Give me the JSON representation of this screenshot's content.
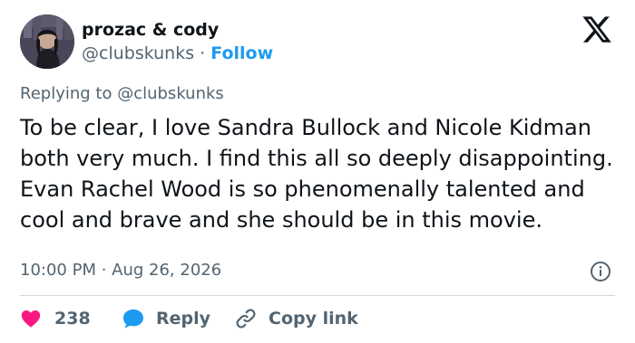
{
  "author": {
    "display_name": "prozac & cody",
    "handle": "@clubskunks",
    "separator": " · ",
    "follow_label": "Follow"
  },
  "replying": {
    "prefix": "Replying to ",
    "mention": "@clubskunks"
  },
  "tweet": {
    "text": "To be clear, I love Sandra Bullock and Nicole Kidman both very much. I find this all so deeply disappointing. Evan Rachel Wood is so phenomenally talented and cool and brave and she should be in this movie.",
    "timestamp": "10:00 PM · Aug 26, 2026"
  },
  "actions": {
    "like_count": "238",
    "reply_label": "Reply",
    "copy_link_label": "Copy link"
  },
  "icons": {
    "logo": "x-logo-icon",
    "info": "info-icon",
    "like": "heart-icon",
    "reply": "speech-bubble-icon",
    "copy": "link-icon"
  },
  "colors": {
    "accent": "#1d9bf0",
    "like": "#f91880",
    "text_primary": "#0f1419",
    "text_secondary": "#536471",
    "divider": "#cfd9de"
  }
}
